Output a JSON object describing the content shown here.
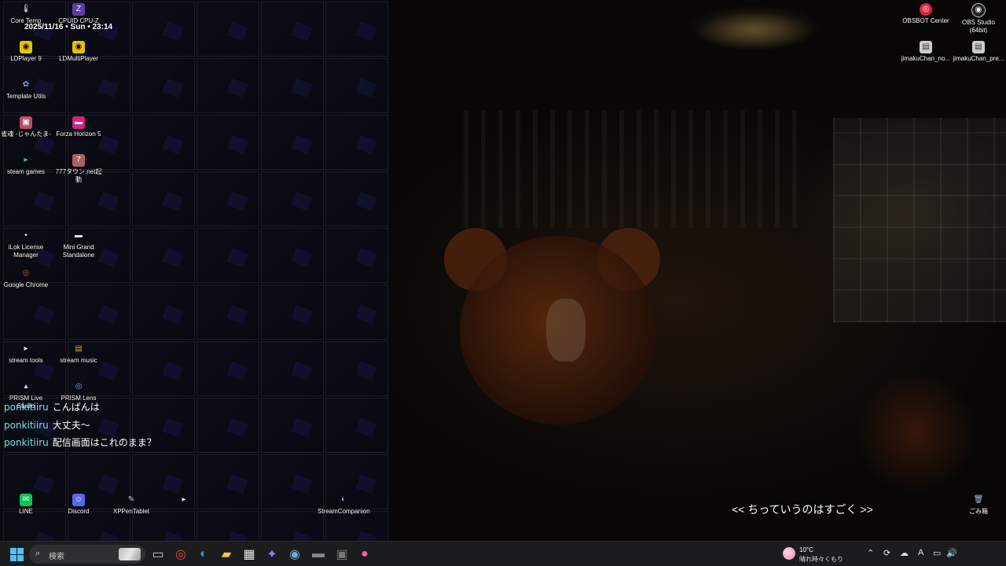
{
  "clock_overlay": "2025/11/16 • Sun • 23:14",
  "desktop_icons_left": [
    {
      "label": "Core Temp",
      "color": "#cfcfcf",
      "glyph": "🌡"
    },
    {
      "label": "CPUID CPU-Z",
      "color": "#5b3ea6",
      "glyph": "Z"
    },
    {
      "label": "LDPlayer 9",
      "color": "#e6c300",
      "glyph": "◉"
    },
    {
      "label": "LDMultiPlayer",
      "color": "#e6c300",
      "glyph": "◉"
    },
    {
      "label": "Template Utils",
      "color": "#3a7bd5",
      "glyph": "✿"
    },
    {
      "label": "雀魂 -じゃんたま-",
      "color": "#c04a6a",
      "glyph": "▣"
    },
    {
      "label": "Forza Horizon 5",
      "color": "#d6227f",
      "glyph": "▬"
    },
    {
      "label": "steam games",
      "color": "#2f8f2f",
      "glyph": "▸"
    },
    {
      "label": "777タウン.net起動",
      "color": "#b06060",
      "glyph": "7"
    },
    {
      "label": "iLok License\nManager",
      "color": "#dddddd",
      "glyph": "▪"
    },
    {
      "label": "Mini Grand\nStandalone",
      "color": "#dddddd",
      "glyph": "▬"
    },
    {
      "label": "Google Chrome",
      "color": "#e8453c",
      "glyph": "◎"
    },
    {
      "label": "stream tools",
      "color": "#dddddd",
      "glyph": "▸"
    },
    {
      "label": "stream music",
      "color": "#d2a642",
      "glyph": "▤"
    },
    {
      "label": "PRISM Live Studio",
      "color": "#dddddd",
      "glyph": "▴"
    },
    {
      "label": "PRISM Lens",
      "color": "#7da7ff",
      "glyph": "◎"
    }
  ],
  "desktop_icons_bottom": [
    {
      "label": "LINE",
      "color": "#06c755",
      "glyph": "✉"
    },
    {
      "label": "Discord",
      "color": "#5865f2",
      "glyph": "☺"
    },
    {
      "label": "XPPenTablet",
      "color": "#cccccc",
      "glyph": "✎"
    },
    {
      "label": "",
      "color": "#dddddd",
      "glyph": "▸"
    },
    {
      "label": "StreamCompanion",
      "color": "#9ab",
      "glyph": "◐"
    }
  ],
  "desktop_icons_right": [
    {
      "label": "OBSBOT Center",
      "color": "#e0233a",
      "glyph": "◎"
    },
    {
      "label": "OBS Studio (64bit)",
      "color": "#222222",
      "glyph": "◉"
    },
    {
      "label": "jimakuChan_no...",
      "color": "#cccccc",
      "glyph": "▤"
    },
    {
      "label": "jimakuChan_pre...",
      "color": "#cccccc",
      "glyph": "▤"
    },
    {
      "label": "ごみ箱",
      "color": "#9ac3ee",
      "glyph": "🗑"
    }
  ],
  "chat": [
    {
      "user": "ponkitiiru",
      "message": "こんばんは"
    },
    {
      "user": "ponkitiiru",
      "message": "大丈夫〜"
    },
    {
      "user": "ponkitiiru",
      "message": "配信画面はこれのまま？"
    }
  ],
  "subtitle": "<< ちっていうのはすごく >>",
  "taskbar": {
    "search_placeholder": "検索",
    "pinned": [
      {
        "name": "task-view",
        "glyph": "▭",
        "color": "#cccccc"
      },
      {
        "name": "chrome",
        "glyph": "◎",
        "color": "#e8453c"
      },
      {
        "name": "edge",
        "glyph": "◐",
        "color": "#1fa2d8"
      },
      {
        "name": "file-explorer",
        "glyph": "▰",
        "color": "#f4c542"
      },
      {
        "name": "microsoft-store",
        "glyph": "▦",
        "color": "#e8e8e8"
      },
      {
        "name": "copilot",
        "glyph": "✦",
        "color": "#8f7cff"
      },
      {
        "name": "steam",
        "glyph": "◉",
        "color": "#6ea8d8"
      },
      {
        "name": "app-dark",
        "glyph": "▬",
        "color": "#888888"
      },
      {
        "name": "app-photo",
        "glyph": "▣",
        "color": "#777777"
      },
      {
        "name": "app-pink",
        "glyph": "●",
        "color": "#ff5fa8"
      }
    ],
    "weather": {
      "temp": "10°C",
      "condition": "晴れ時々くもり"
    },
    "ime_indicator": "A"
  }
}
